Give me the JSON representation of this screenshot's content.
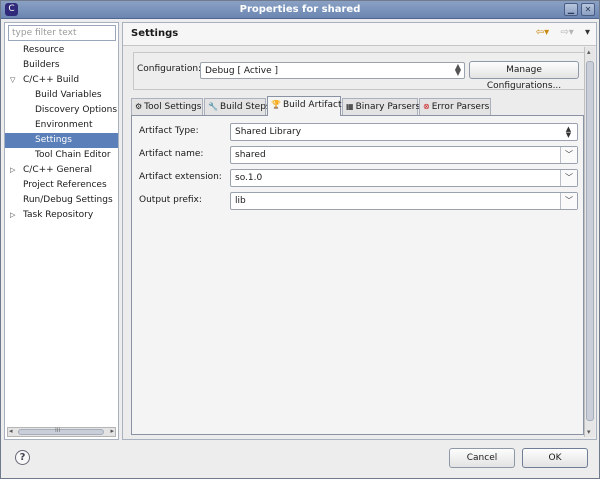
{
  "window": {
    "title": "Properties for shared",
    "app_icon": "C",
    "colors": {
      "titlebar": "#7a93bd",
      "selection": "#5b7fb8"
    }
  },
  "sidebar": {
    "filter_placeholder": "type filter text",
    "items": [
      {
        "label": "Resource"
      },
      {
        "label": "Builders"
      },
      {
        "label": "C/C++ Build",
        "expanded": true
      },
      {
        "label": "Build Variables"
      },
      {
        "label": "Discovery Options"
      },
      {
        "label": "Environment"
      },
      {
        "label": "Settings",
        "selected": true
      },
      {
        "label": "Tool Chain Editor"
      },
      {
        "label": "C/C++ General",
        "expanded": false
      },
      {
        "label": "Project References"
      },
      {
        "label": "Run/Debug Settings"
      },
      {
        "label": "Task Repository",
        "expanded": false
      }
    ],
    "scroll_glyph": "III"
  },
  "main": {
    "title": "Settings",
    "nav": {
      "back": "⇦▾",
      "forward": "⇨▾",
      "menu": "▾"
    },
    "configuration": {
      "label": "Configuration:",
      "value": "Debug  [ Active ]",
      "manage_label": "Manage Configurations..."
    },
    "tabs": [
      {
        "label": "Tool Settings",
        "icon": "⚙"
      },
      {
        "label": "Build Steps",
        "icon": "🔧"
      },
      {
        "label": "Build Artifact",
        "icon": "🏆",
        "active": true
      },
      {
        "label": "Binary Parsers",
        "icon": "▦"
      },
      {
        "label": "Error Parsers",
        "icon": "⊗"
      }
    ],
    "artifact": {
      "type_label": "Artifact Type:",
      "type_value": "Shared Library",
      "name_label": "Artifact name:",
      "name_value": "shared",
      "ext_label": "Artifact extension:",
      "ext_value": "so.1.0",
      "prefix_label": "Output prefix:",
      "prefix_value": "lib"
    }
  },
  "footer": {
    "help": "?",
    "cancel_label": "Cancel",
    "ok_label": "OK"
  }
}
